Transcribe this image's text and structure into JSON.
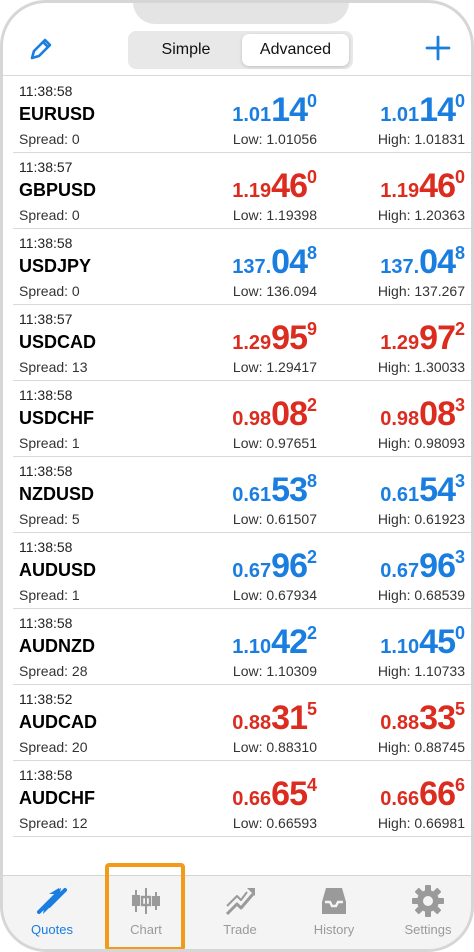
{
  "header": {
    "segments": {
      "simple": "Simple",
      "advanced": "Advanced"
    }
  },
  "quotes": [
    {
      "time": "11:38:58",
      "symbol": "EURUSD",
      "spread": "Spread: 0",
      "bid": {
        "p1": "1.01",
        "p2": "14",
        "p3": "0",
        "color": "blue"
      },
      "ask": {
        "p1": "1.01",
        "p2": "14",
        "p3": "0",
        "color": "blue"
      },
      "low": "Low: 1.01056",
      "high": "High: 1.01831"
    },
    {
      "time": "11:38:57",
      "symbol": "GBPUSD",
      "spread": "Spread: 0",
      "bid": {
        "p1": "1.19",
        "p2": "46",
        "p3": "0",
        "color": "red"
      },
      "ask": {
        "p1": "1.19",
        "p2": "46",
        "p3": "0",
        "color": "red"
      },
      "low": "Low: 1.19398",
      "high": "High: 1.20363"
    },
    {
      "time": "11:38:58",
      "symbol": "USDJPY",
      "spread": "Spread: 0",
      "bid": {
        "p1": "137.",
        "p2": "04",
        "p3": "8",
        "color": "blue"
      },
      "ask": {
        "p1": "137.",
        "p2": "04",
        "p3": "8",
        "color": "blue"
      },
      "low": "Low: 136.094",
      "high": "High: 137.267"
    },
    {
      "time": "11:38:57",
      "symbol": "USDCAD",
      "spread": "Spread: 13",
      "bid": {
        "p1": "1.29",
        "p2": "95",
        "p3": "9",
        "color": "red"
      },
      "ask": {
        "p1": "1.29",
        "p2": "97",
        "p3": "2",
        "color": "red"
      },
      "low": "Low: 1.29417",
      "high": "High: 1.30033"
    },
    {
      "time": "11:38:58",
      "symbol": "USDCHF",
      "spread": "Spread: 1",
      "bid": {
        "p1": "0.98",
        "p2": "08",
        "p3": "2",
        "color": "red"
      },
      "ask": {
        "p1": "0.98",
        "p2": "08",
        "p3": "3",
        "color": "red"
      },
      "low": "Low: 0.97651",
      "high": "High: 0.98093"
    },
    {
      "time": "11:38:58",
      "symbol": "NZDUSD",
      "spread": "Spread: 5",
      "bid": {
        "p1": "0.61",
        "p2": "53",
        "p3": "8",
        "color": "blue"
      },
      "ask": {
        "p1": "0.61",
        "p2": "54",
        "p3": "3",
        "color": "blue"
      },
      "low": "Low: 0.61507",
      "high": "High: 0.61923"
    },
    {
      "time": "11:38:58",
      "symbol": "AUDUSD",
      "spread": "Spread: 1",
      "bid": {
        "p1": "0.67",
        "p2": "96",
        "p3": "2",
        "color": "blue"
      },
      "ask": {
        "p1": "0.67",
        "p2": "96",
        "p3": "3",
        "color": "blue"
      },
      "low": "Low: 0.67934",
      "high": "High: 0.68539"
    },
    {
      "time": "11:38:58",
      "symbol": "AUDNZD",
      "spread": "Spread: 28",
      "bid": {
        "p1": "1.10",
        "p2": "42",
        "p3": "2",
        "color": "blue"
      },
      "ask": {
        "p1": "1.10",
        "p2": "45",
        "p3": "0",
        "color": "blue"
      },
      "low": "Low: 1.10309",
      "high": "High: 1.10733"
    },
    {
      "time": "11:38:52",
      "symbol": "AUDCAD",
      "spread": "Spread: 20",
      "bid": {
        "p1": "0.88",
        "p2": "31",
        "p3": "5",
        "color": "red"
      },
      "ask": {
        "p1": "0.88",
        "p2": "33",
        "p3": "5",
        "color": "red"
      },
      "low": "Low: 0.88310",
      "high": "High: 0.88745"
    },
    {
      "time": "11:38:58",
      "symbol": "AUDCHF",
      "spread": "Spread: 12",
      "bid": {
        "p1": "0.66",
        "p2": "65",
        "p3": "4",
        "color": "red"
      },
      "ask": {
        "p1": "0.66",
        "p2": "66",
        "p3": "6",
        "color": "red"
      },
      "low": "Low: 0.66593",
      "high": "High: 0.66981"
    }
  ],
  "tabs": [
    {
      "label": "Quotes",
      "icon": "quotes-icon",
      "active": true
    },
    {
      "label": "Chart",
      "icon": "chart-icon",
      "active": false
    },
    {
      "label": "Trade",
      "icon": "trade-icon",
      "active": false
    },
    {
      "label": "History",
      "icon": "history-icon",
      "active": false
    },
    {
      "label": "Settings",
      "icon": "settings-icon",
      "active": false
    }
  ],
  "colors": {
    "blue": "#1a7de0",
    "red": "#dc2b1f",
    "highlight": "#f39a1b",
    "tab_inactive": "#9a9a9a"
  }
}
